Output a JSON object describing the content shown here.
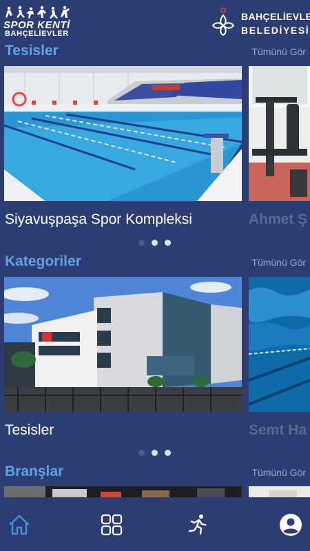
{
  "header": {
    "left_logo": {
      "line1": "SPOR KENTİ",
      "line2": "BAHÇELİEVLER"
    },
    "right_logo": {
      "line1": "BAHÇELİEVLER",
      "line2": "BELEDİYESİ"
    }
  },
  "sections": [
    {
      "title": "Tesisler",
      "see_all": "Tümünü Gör",
      "card_title": "Siyavuşpaşa Spor Kompleksi",
      "next_card_title": "Ahmet Ş",
      "active_dot": 0
    },
    {
      "title": "Kategoriler",
      "see_all": "Tümünü Gör",
      "card_title": "Tesisler",
      "next_card_title": "Semt Ha",
      "active_dot": 0
    },
    {
      "title": "Branşlar",
      "see_all": "Tümünü Gör"
    }
  ],
  "tabbar": {
    "items": [
      {
        "icon": "home-icon",
        "active": true
      },
      {
        "icon": "grid-icon",
        "active": false
      },
      {
        "icon": "running-icon",
        "active": false
      },
      {
        "icon": "profile-icon",
        "active": false
      }
    ]
  },
  "colors": {
    "background": "#2b3d72",
    "section_title": "#5ea3e6",
    "see_all": "#9aa6c4",
    "active_tab": "#4a90d9",
    "dot_active": "#4f5d80",
    "dot_inactive": "#dde2ee"
  }
}
